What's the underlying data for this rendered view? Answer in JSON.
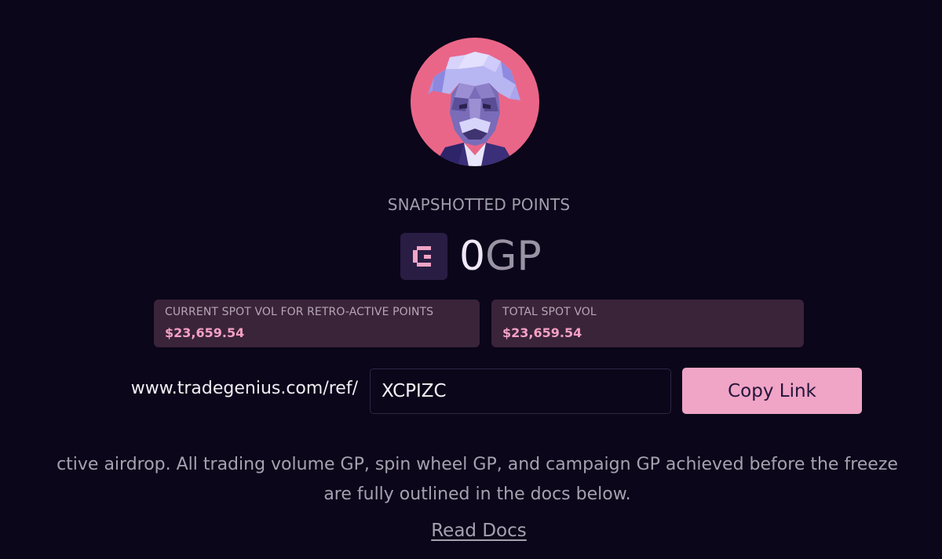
{
  "profile": {
    "avatar_icon": "einstein-lowpoly-avatar"
  },
  "points": {
    "label": "SNAPSHOTTED POINTS",
    "icon": "gp-logo-icon",
    "value": "0",
    "unit": "GP"
  },
  "stats": [
    {
      "label": "CURRENT SPOT VOL FOR RETRO-ACTIVE POINTS",
      "value": "$23,659.54"
    },
    {
      "label": "TOTAL SPOT VOL",
      "value": "$23,659.54"
    }
  ],
  "referral": {
    "prefix": "www.tradegenius.com/ref/",
    "code": "XCPIZC",
    "copy_label": "Copy Link"
  },
  "description": {
    "line1": "ctive airdrop. All trading volume GP, spin wheel GP, and campaign GP achieved before the freeze",
    "line2": "are fully outlined in the docs below."
  },
  "docs_link": "Read Docs",
  "colors": {
    "background": "#0b0619",
    "accent_pink": "#f0a4c6",
    "avatar_bg": "#ea6688",
    "card_bg": "#3a2439"
  }
}
